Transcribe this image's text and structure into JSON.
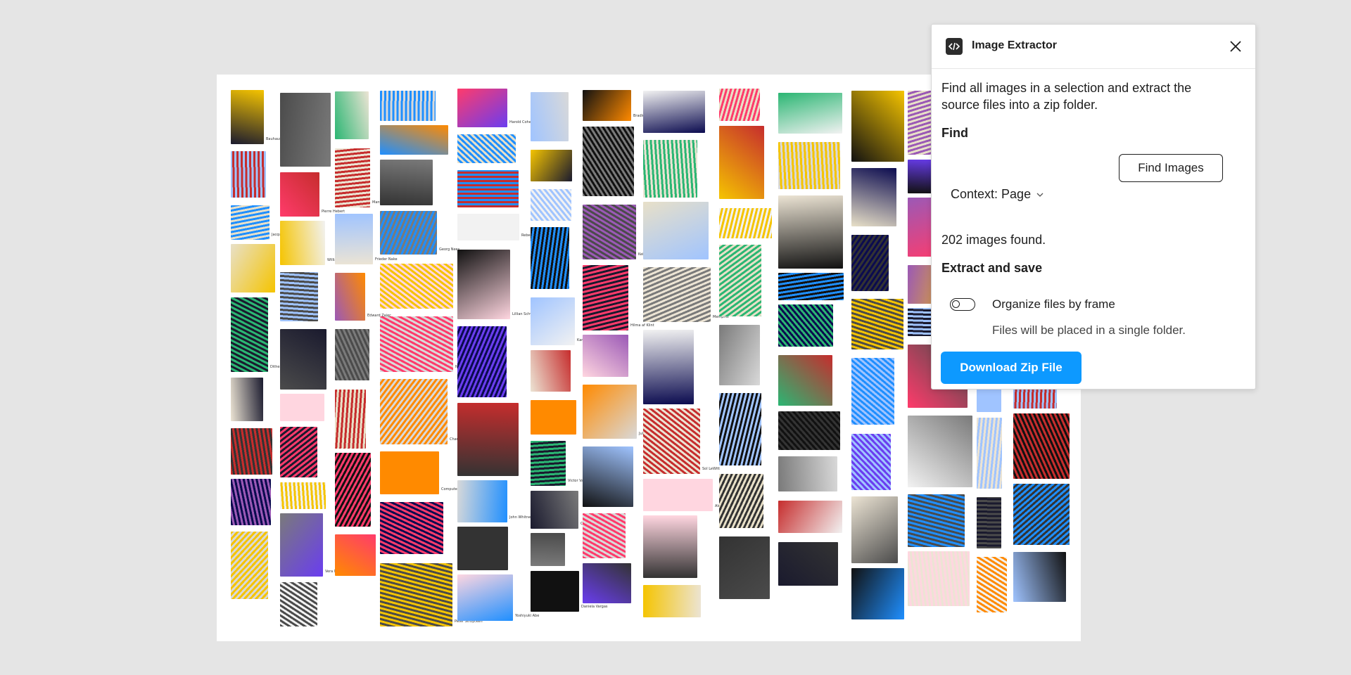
{
  "canvas": {
    "captions": [
      "Bauhaus Tape",
      "Jacquard machine",
      "Dithering",
      "Pierre Hebert",
      "William A. Fetter",
      "Vera Molnar",
      "Manfred Mohr",
      "Frieder Nake",
      "Edward Zajec",
      "Georg Nees",
      "Nicolas Schöffer",
      "Charles Csuri",
      "Computer Rosetta",
      "Peter Struycken",
      "Harold Cohen",
      "Rebecca Allen",
      "Lillian Schwartz",
      "John Whitney",
      "Yoshiyuki Abe",
      "Karl Gerstner",
      "Victor Vasarely",
      "Carlos Cruz-Diez",
      "Daniela Vargas",
      "Bradley Moore",
      "Keith Haring",
      "Hilma af Klint",
      "Julio Le Parc",
      "Memphis",
      "Sol LeWitt",
      "Alexander Girard"
    ],
    "colors": {
      "background": "#e5e5e5",
      "frame": "#ffffff"
    }
  },
  "plugin": {
    "title": "Image Extractor",
    "icon": "code-icon",
    "description": "Find all images in a selection and extract the source files into a zip folder.",
    "find_label": "Find",
    "context_label": "Context: Page",
    "find_button": "Find Images",
    "count_text": "202 images found.",
    "extract_label": "Extract and save",
    "toggle_label": "Organize files by frame",
    "toggle_on": false,
    "toggle_help": "Files will be placed in a single folder.",
    "download_button": "Download Zip File",
    "accent": "#0d99ff"
  }
}
